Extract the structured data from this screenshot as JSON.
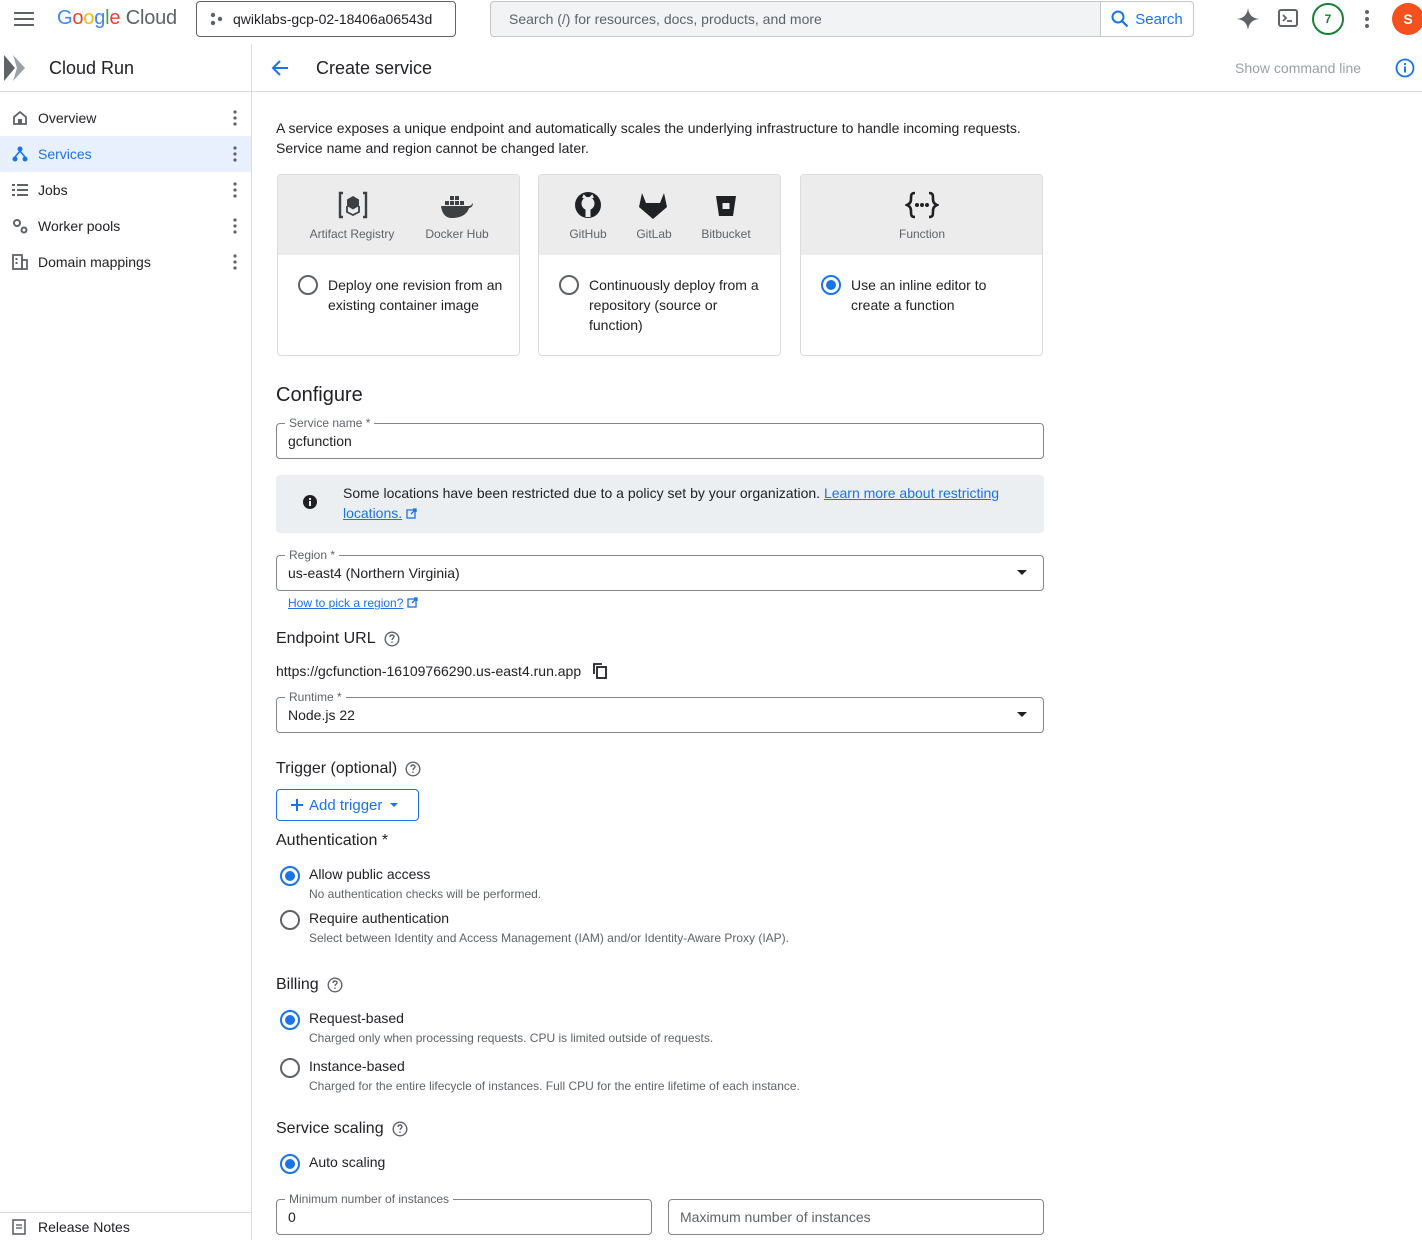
{
  "topbar": {
    "logo": "Google Cloud",
    "project": "qwiklabs-gcp-02-18406a06543d",
    "search_placeholder": "Search (/) for resources, docs, products, and more",
    "search_button": "Search",
    "notifications_count": "7",
    "avatar_letter": "S"
  },
  "sidebar": {
    "product": "Cloud Run",
    "items": [
      {
        "label": "Overview",
        "icon": "home-icon"
      },
      {
        "label": "Services",
        "icon": "services-icon",
        "active": true
      },
      {
        "label": "Jobs",
        "icon": "list-icon"
      },
      {
        "label": "Worker pools",
        "icon": "gears-icon"
      },
      {
        "label": "Domain mappings",
        "icon": "building-icon"
      }
    ],
    "release_notes": "Release Notes"
  },
  "header": {
    "title": "Create service",
    "show_command_line": "Show command line"
  },
  "intro": {
    "line1": "A service exposes a unique endpoint and automatically scales the underlying infrastructure to handle incoming requests.",
    "line2": "Service name and region cannot be changed later."
  },
  "source_cards": [
    {
      "icons": [
        "Artifact Registry",
        "Docker Hub"
      ],
      "option": "Deploy one revision from an existing container image",
      "selected": false
    },
    {
      "icons": [
        "GitHub",
        "GitLab",
        "Bitbucket"
      ],
      "option": "Continuously deploy from a repository (source or function)",
      "selected": false
    },
    {
      "icons": [
        "Function"
      ],
      "option": "Use an inline editor to create a function",
      "selected": true
    }
  ],
  "configure": {
    "heading": "Configure",
    "service_name_label": "Service name *",
    "service_name_value": "gcfunction",
    "notice_text": "Some locations have been restricted due to a policy set by your organization.",
    "notice_link": "Learn more about restricting",
    "notice_link2": "locations.",
    "region_label": "Region *",
    "region_value": "us-east4 (Northern Virginia)",
    "region_help": "How to pick a region?",
    "endpoint_heading": "Endpoint URL",
    "endpoint_url": "https://gcfunction-16109766290.us-east4.run.app",
    "runtime_label": "Runtime *",
    "runtime_value": "Node.js 22",
    "trigger_heading": "Trigger (optional)",
    "add_trigger": "Add trigger"
  },
  "authentication": {
    "heading": "Authentication *",
    "options": [
      {
        "label": "Allow public access",
        "desc": "No authentication checks will be performed.",
        "selected": true
      },
      {
        "label": "Require authentication",
        "desc": "Select between Identity and Access Management (IAM) and/or Identity-Aware Proxy (IAP).",
        "selected": false
      }
    ]
  },
  "billing": {
    "heading": "Billing",
    "options": [
      {
        "label": "Request-based",
        "desc": "Charged only when processing requests. CPU is limited outside of requests.",
        "selected": true
      },
      {
        "label": "Instance-based",
        "desc": "Charged for the entire lifecycle of instances. Full CPU for the entire lifetime of each instance.",
        "selected": false
      }
    ]
  },
  "scaling": {
    "heading": "Service scaling",
    "auto_label": "Auto scaling",
    "min_label": "Minimum number of instances",
    "min_value": "0",
    "max_placeholder": "Maximum number of instances"
  }
}
